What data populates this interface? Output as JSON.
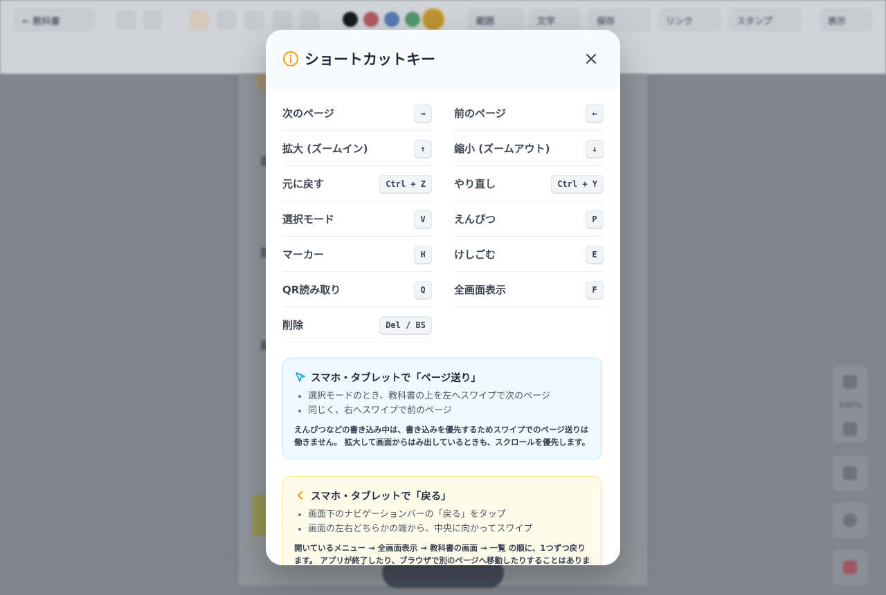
{
  "background": {
    "topbar": {
      "back_label": "← 教科書",
      "tool_buttons": [
        "範囲",
        "文字",
        "保存",
        "リンク",
        "スタンプ",
        "表示"
      ]
    },
    "zoom_label": "100%"
  },
  "modal": {
    "title": "ショートカットキー",
    "shortcuts": [
      {
        "label": "次のページ",
        "key": "→"
      },
      {
        "label": "前のページ",
        "key": "←"
      },
      {
        "label": "拡大 (ズームイン)",
        "key": "↑"
      },
      {
        "label": "縮小 (ズームアウト)",
        "key": "↓"
      },
      {
        "label": "元に戻す",
        "key": "Ctrl + Z"
      },
      {
        "label": "やり直し",
        "key": "Ctrl + Y"
      },
      {
        "label": "選択モード",
        "key": "V"
      },
      {
        "label": "えんぴつ",
        "key": "P"
      },
      {
        "label": "マーカー",
        "key": "H"
      },
      {
        "label": "けしごむ",
        "key": "E"
      },
      {
        "label": "QR読み取り",
        "key": "Q"
      },
      {
        "label": "全画面表示",
        "key": "F"
      },
      {
        "label": "削除",
        "key": "Del / BS"
      }
    ],
    "page_turn_box": {
      "title": "スマホ・タブレットで「ページ送り」",
      "items": [
        "選択モードのとき、教科書の上を左へスワイプで次のページ",
        "同じく、右へスワイプで前のページ"
      ],
      "note": "えんぴつなどの書き込み中は、書き込みを優先するためスワイプでのページ送りは働きません。 拡大して画面からはみ出しているときも、スクロールを優先します。"
    },
    "back_box": {
      "title": "スマホ・タブレットで「戻る」",
      "items": [
        "画面下のナビゲーションバーの「戻る」をタップ",
        "画面の左右どちらかの端から、中央に向かってスワイプ"
      ],
      "note": "開いているメニュー → 全画面表示 → 教科書の画面 → 一覧 の順に、1つずつ戻ります。 アプリが終了したり、ブラウザで別のページへ移動したりすることはありません。"
    }
  },
  "colors": {
    "accent_info": "#f59e0b",
    "swatches": [
      "#111111",
      "#ef4444",
      "#3b82f6",
      "#22c55e",
      "#f59e0b"
    ]
  }
}
